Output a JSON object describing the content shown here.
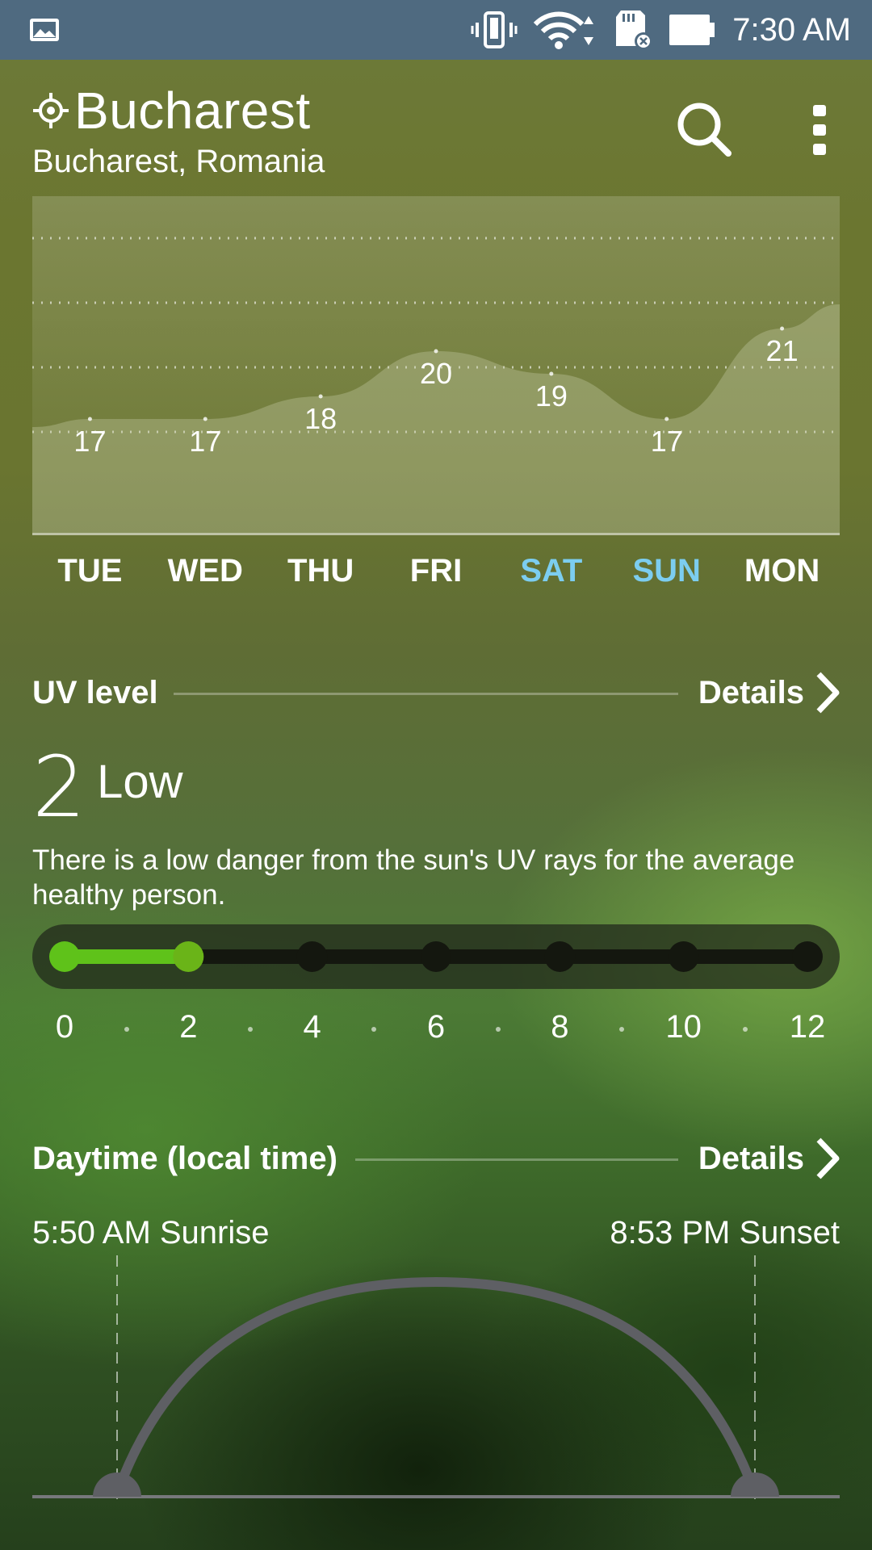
{
  "status_bar": {
    "time": "7:30 AM",
    "icons": [
      "gallery-icon",
      "vibrate-icon",
      "wifi-icon",
      "sd-card-icon",
      "battery-icon"
    ]
  },
  "header": {
    "city": "Bucharest",
    "subtitle": "Bucharest, Romania",
    "icons": [
      "location-icon",
      "search-icon",
      "more-vert-icon"
    ]
  },
  "forecast": {
    "days": [
      {
        "label": "TUE",
        "temp": "17",
        "weekend": false
      },
      {
        "label": "WED",
        "temp": "17",
        "weekend": false
      },
      {
        "label": "THU",
        "temp": "18",
        "weekend": false
      },
      {
        "label": "FRI",
        "temp": "20",
        "weekend": false
      },
      {
        "label": "SAT",
        "temp": "19",
        "weekend": true
      },
      {
        "label": "SUN",
        "temp": "17",
        "weekend": true
      },
      {
        "label": "MON",
        "temp": "21",
        "weekend": false
      }
    ],
    "weekend_color": "#7ccdf0"
  },
  "uv": {
    "section_title": "UV level",
    "details_label": "Details",
    "value": "2",
    "level": "Low",
    "description": "There is a low danger from the sun's UV rays for the average healthy person.",
    "scale_labels": [
      "0",
      "2",
      "4",
      "6",
      "8",
      "10",
      "12"
    ],
    "current_index": 1,
    "accent_color": "#5fc21a"
  },
  "daytime": {
    "section_title": "Daytime (local time)",
    "details_label": "Details",
    "sunrise": "5:50 AM Sunrise",
    "sunset": "8:53 PM Sunset"
  }
}
